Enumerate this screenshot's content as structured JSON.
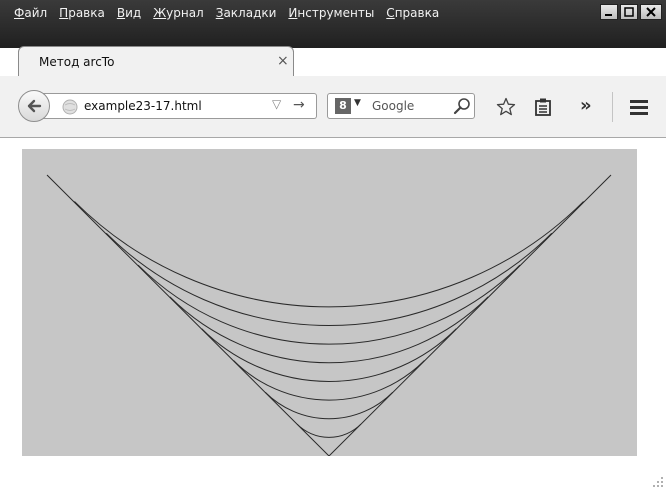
{
  "menu": {
    "items": [
      {
        "acc": "Ф",
        "rest": "айл"
      },
      {
        "acc": "П",
        "rest": "равка"
      },
      {
        "acc": "В",
        "rest": "ид"
      },
      {
        "acc": "Ж",
        "rest": "урнал"
      },
      {
        "acc": "З",
        "rest": "акладки"
      },
      {
        "acc": "И",
        "rest": "нструменты"
      },
      {
        "acc": "С",
        "rest": "правка"
      }
    ]
  },
  "tab": {
    "title": "Метод arcTo",
    "close": "×"
  },
  "new_tab": "+",
  "address": {
    "url": "example23-17.html"
  },
  "search": {
    "engine_badge": "8",
    "placeholder": "Google"
  },
  "toolbar": {
    "overflow": "»"
  },
  "colors": {
    "titlebar": "#2a2a2a",
    "toolbar": "#f1f1f1",
    "canvas_bg": "#c6c6c6",
    "stroke": "#2a2a2a"
  },
  "figure": {
    "description": "arcTo demo: two lines meeting at a V with nested tangent arcs",
    "arc_count": 8
  }
}
